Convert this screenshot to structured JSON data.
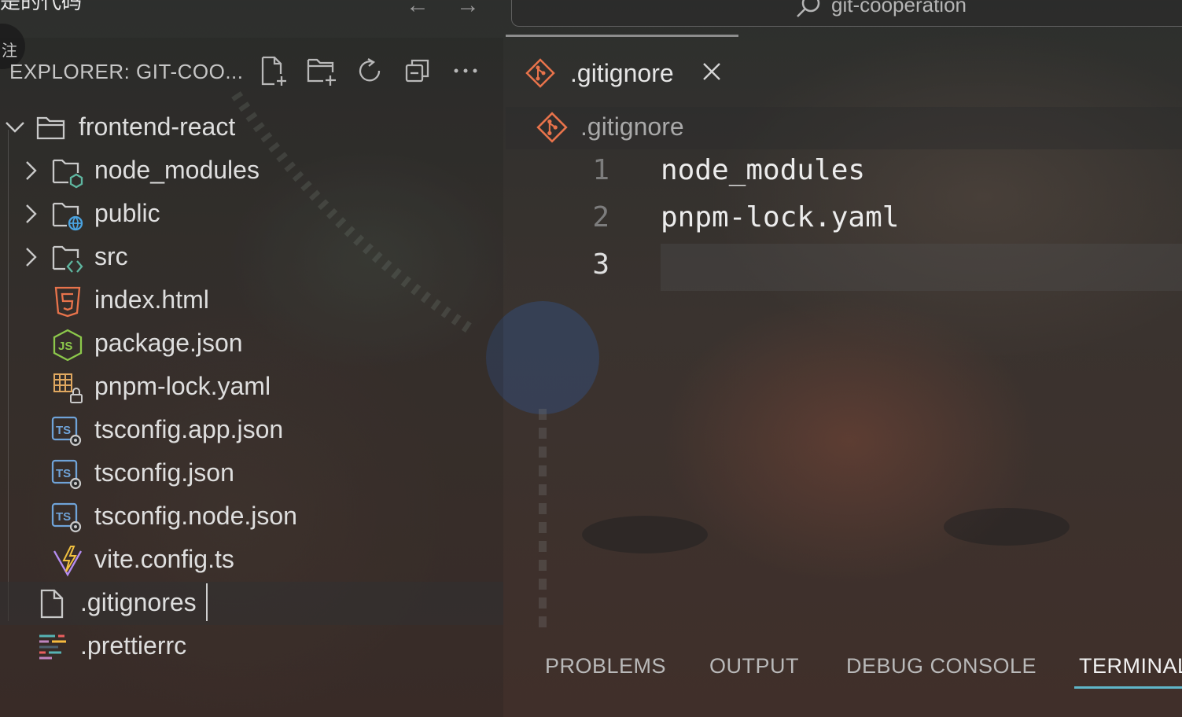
{
  "titlebar": {
    "title_fragment": "是的代码",
    "back_arrow": "←",
    "forward_arrow": "→",
    "search_text": "git-cooperation",
    "badge_char": "注"
  },
  "explorer": {
    "header": "EXPLORER: GIT-COO...",
    "actions": [
      "new-file-icon",
      "new-folder-icon",
      "refresh-icon",
      "collapse-all-icon",
      "more-icon"
    ],
    "tree": [
      {
        "label": "frontend-react",
        "type": "folder-open",
        "depth": 0
      },
      {
        "label": "node_modules",
        "type": "folder-node",
        "depth": 1
      },
      {
        "label": "public",
        "type": "folder-public",
        "depth": 1
      },
      {
        "label": "src",
        "type": "folder-src",
        "depth": 1
      },
      {
        "label": "index.html",
        "type": "html",
        "depth": 1
      },
      {
        "label": "package.json",
        "type": "nodejs",
        "depth": 1
      },
      {
        "label": "pnpm-lock.yaml",
        "type": "lock",
        "depth": 1
      },
      {
        "label": "tsconfig.app.json",
        "type": "tsconfig",
        "depth": 1
      },
      {
        "label": "tsconfig.json",
        "type": "tsconfig",
        "depth": 1
      },
      {
        "label": "tsconfig.node.json",
        "type": "tsconfig",
        "depth": 1
      },
      {
        "label": "vite.config.ts",
        "type": "vite",
        "depth": 1
      },
      {
        "label": ".gitignores",
        "type": "file-renaming",
        "depth": 0
      },
      {
        "label": ".prettierrc",
        "type": "prettier",
        "depth": 0
      }
    ]
  },
  "editor": {
    "tab_label": ".gitignore",
    "breadcrumb": ".gitignore",
    "lines": [
      {
        "number": "1",
        "text": "node_modules"
      },
      {
        "number": "2",
        "text": "pnpm-lock.yaml"
      },
      {
        "number": "3",
        "text": ""
      }
    ],
    "active_line": 3
  },
  "panel": {
    "tabs": [
      "PROBLEMS",
      "OUTPUT",
      "DEBUG CONSOLE",
      "TERMINAL"
    ],
    "active_tab": "TERMINAL"
  },
  "colors": {
    "git_icon": "#e8734b",
    "html_icon": "#e8734b",
    "node_icon": "#8cc84b",
    "ts_icon": "#6fa3d8",
    "folder_badge": "#5fb6a0",
    "public_badge": "#4aa3e0",
    "vite_icon": "#b48cf0",
    "terminal_underline": "#5fb6c9"
  }
}
